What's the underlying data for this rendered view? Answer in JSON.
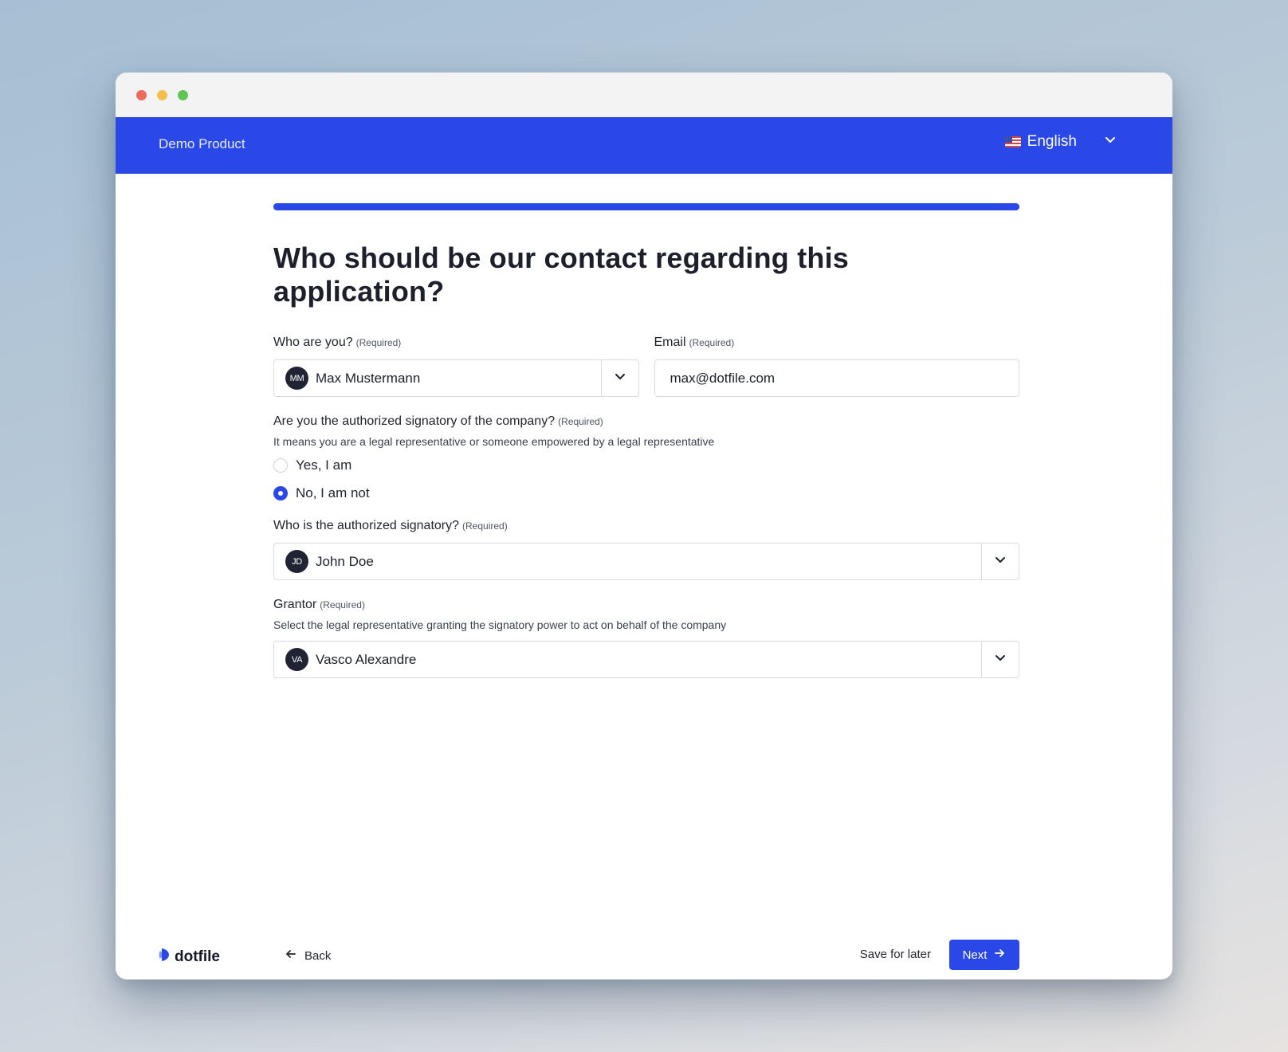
{
  "app": {
    "brand": "Demo Product",
    "language": "English",
    "progress": 1.0
  },
  "form": {
    "title": "Who should be our contact regarding this application?",
    "required_tag": "(Required)",
    "who_are_you": {
      "label": "Who are you?",
      "selected_initials": "MM",
      "selected_name": "Max Mustermann"
    },
    "email": {
      "label": "Email",
      "value": "max@dotfile.com"
    },
    "authorized_question": {
      "label": "Are you the authorized signatory of the company?",
      "helper": "It means you are a legal representative or someone empowered by a legal representative",
      "options": [
        {
          "label": "Yes, I am",
          "selected": false
        },
        {
          "label": "No, I am not",
          "selected": true
        }
      ]
    },
    "signatory": {
      "label": "Who is the authorized signatory?",
      "selected_initials": "JD",
      "selected_name": "John Doe"
    },
    "grantor": {
      "label": "Grantor",
      "helper": "Select the legal representative granting the signatory power to act on behalf of the company",
      "selected_initials": "VA",
      "selected_name": "Vasco Alexandre"
    }
  },
  "footer": {
    "logo_text": "dotfile",
    "back_label": "Back",
    "save_label": "Save for later",
    "next_label": "Next"
  },
  "colors": {
    "accent": "#2a48e8",
    "text": "#1d1f2b",
    "border": "#d8dbe2"
  }
}
